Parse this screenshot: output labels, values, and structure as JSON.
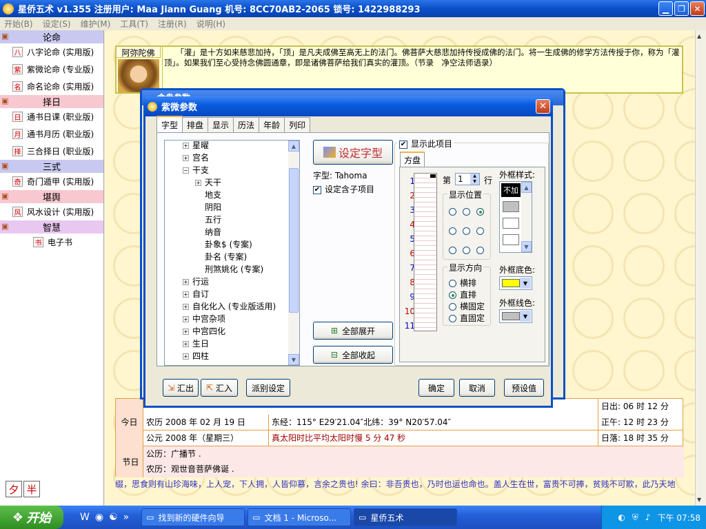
{
  "app": {
    "title": "星侨五术 v1.355  注册用户: Maa Jiann Guang  机号: 8CC70AB2-2065  锁号: 1422988293",
    "menu": [
      "开始(B)",
      "设定(S)",
      "维护(M)",
      "工具(T)",
      "注册(R)",
      "说明(H)"
    ]
  },
  "sidebar": [
    {
      "type": "cat",
      "label": "论命",
      "bg": "#c8c8f0",
      "icon": "people-icon"
    },
    {
      "type": "item",
      "label": "八字论命 (实用版)",
      "glyph": "八"
    },
    {
      "type": "item",
      "label": "紫微论命 (专业版)",
      "glyph": "紫"
    },
    {
      "type": "item",
      "label": "命名论命 (实用版)",
      "glyph": "名"
    },
    {
      "type": "cat",
      "label": "择日",
      "bg": "#f8c8d0",
      "icon": "calendar-icon"
    },
    {
      "type": "item",
      "label": "通书日课 (职业版)",
      "glyph": "日"
    },
    {
      "type": "item",
      "label": "通书月历 (职业版)",
      "glyph": "月"
    },
    {
      "type": "item",
      "label": "三合择日 (职业版)",
      "glyph": "择"
    },
    {
      "type": "cat",
      "label": "三式",
      "bg": "#c8c8f0",
      "icon": "folder-icon"
    },
    {
      "type": "item",
      "label": "奇门遁甲 (实用版)",
      "glyph": "奇"
    },
    {
      "type": "cat",
      "label": "堪舆",
      "bg": "#f8c8d0",
      "icon": "house-icon"
    },
    {
      "type": "item",
      "label": "风水设计 (实用版)",
      "glyph": "风"
    },
    {
      "type": "cat",
      "label": "智慧",
      "bg": "#e8c8f0",
      "icon": "wand-icon"
    },
    {
      "type": "item",
      "label": "电子书",
      "glyph": "书",
      "indent": true
    }
  ],
  "quote": {
    "name": "阿弥陀佛",
    "text": "　　「灌」是十方如来慈悲加持，「顶」是凡夫成佛至高无上的法门。佛菩萨大慈悲加持传授成佛的法门。将一生成佛的修学方法传授于你，称为「灌顶」。如果我们至心受持念佛圆通章，即是诸佛菩萨给我们真实的灌顶。（节录　净空法师语录）"
  },
  "back_window": {
    "title": "命盘参数"
  },
  "dialog": {
    "title": "紫微参数",
    "tabs": [
      "字型",
      "排盘",
      "显示",
      "历法",
      "年龄",
      "列印"
    ],
    "tree": [
      {
        "label": "星曜",
        "level": 0,
        "pm": "+"
      },
      {
        "label": "宫名",
        "level": 0,
        "pm": "+"
      },
      {
        "label": "干支",
        "level": 0,
        "pm": "-"
      },
      {
        "label": "天干",
        "level": 1,
        "pm": "+"
      },
      {
        "label": "地支",
        "level": 2
      },
      {
        "label": "阴阳",
        "level": 2
      },
      {
        "label": "五行",
        "level": 2
      },
      {
        "label": "纳音",
        "level": 2
      },
      {
        "label": "卦象$ (专案)",
        "level": 2
      },
      {
        "label": "卦名 (专案)",
        "level": 2
      },
      {
        "label": "刑煞姚化 (专案)",
        "level": 2
      },
      {
        "label": "行运",
        "level": 0,
        "pm": "+"
      },
      {
        "label": "自订",
        "level": 0,
        "pm": "+"
      },
      {
        "label": "自化化入 (专业版适用)",
        "level": 0,
        "pm": "+"
      },
      {
        "label": "中宫杂项",
        "level": 0,
        "pm": "+"
      },
      {
        "label": "中宫四化",
        "level": 0,
        "pm": "+"
      },
      {
        "label": "生日",
        "level": 0,
        "pm": "+"
      },
      {
        "label": "四柱",
        "level": 0,
        "pm": "+"
      }
    ],
    "set_font_button": "设定字型",
    "font_label": "字型: Tahoma",
    "set_children_label": "设定含子项目",
    "expand_all": "全部展开",
    "collapse_all": "全部收起",
    "show_item_label": "显示此项目",
    "subtab": "方盘",
    "row_numbers": [
      "1",
      "2",
      "3",
      "4",
      "5",
      "6",
      "7",
      "8",
      "9",
      "10",
      "11"
    ],
    "row_prefix": "第",
    "row_value": "1",
    "row_suffix": "行",
    "position_legend": "显示位置",
    "direction_legend": "显示方向",
    "directions": [
      "横排",
      "直排",
      "横固定",
      "直固定"
    ],
    "direction_selected": 1,
    "frame_style_label": "外框样式:",
    "frame_style_first": "不加",
    "frame_bg_label": "外框底色:",
    "frame_bg_color": "#ffff00",
    "frame_line_label": "外框线色:",
    "frame_line_color": "#c0c0c0",
    "export": "汇出",
    "import": "汇入",
    "derive": "派别设定",
    "ok": "确定",
    "cancel": "取消",
    "defaults": "预设值"
  },
  "info": {
    "today_label": "今日",
    "festival_label": "节日",
    "lunar": "农历 2008 年 02 月 19 日",
    "gregorian": "公元 2008 年（星期三）",
    "longitude": "东经：115° E29′21.04″北纬：39° N20′57.04″",
    "solar_time": "真太阳时比平均太阳时慢 5 分 47 秒",
    "sunrise": "日出: 06 时 12 分",
    "noon": "正午: 12 时 23 分",
    "sunset": "日落: 18 时 35 分",
    "fest_gregorian": "公历：广播节 .",
    "fest_lunar": "农历：观世音菩萨佛诞 ."
  },
  "scroll_text": "缀，思食则有山珍海味，上人宠，下人拥，人皆仰慕，言余之贵也! 余曰：非吾贵也，乃时也运也命也。盖人生在世，富贵不可捧，贫贱不可欺，此乃天地",
  "lunar_buttons": [
    "夕",
    "半"
  ],
  "taskbar": {
    "start": "开始",
    "tasks": [
      "找到新的硬件向导",
      "文档 1 - Microso...",
      "星侨五术"
    ],
    "active_task": 2,
    "clock": "下午 07:58"
  }
}
